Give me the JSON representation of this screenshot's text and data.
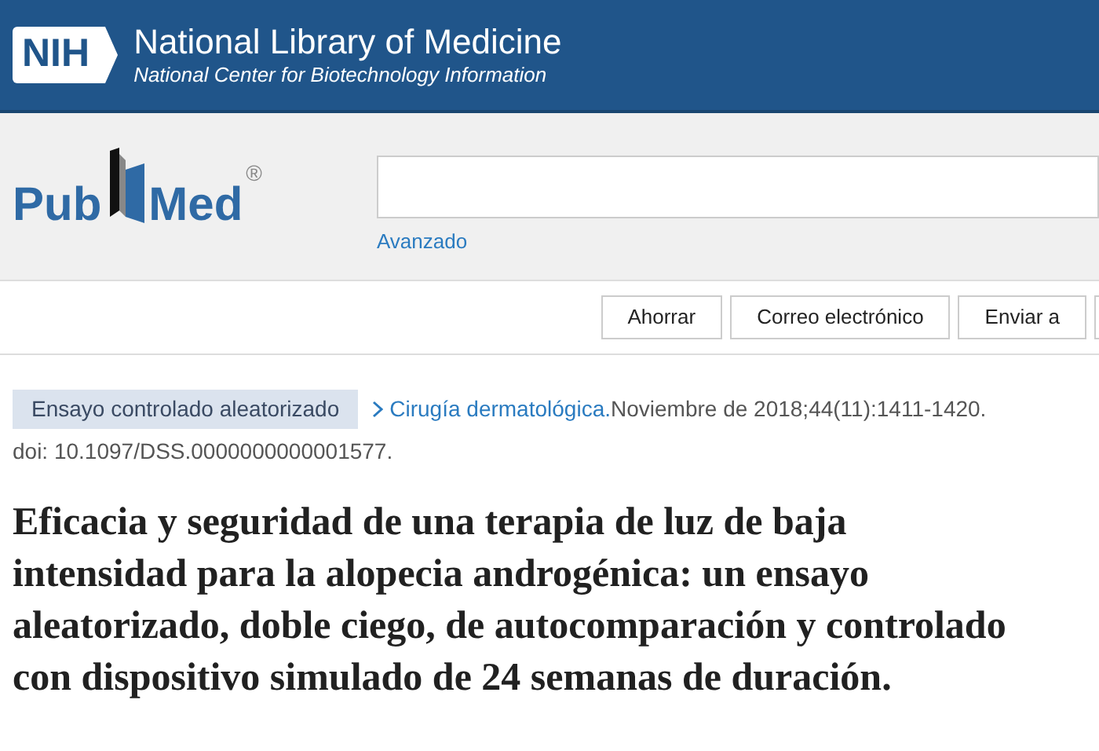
{
  "header": {
    "badge": "NIH",
    "title": "National Library of Medicine",
    "subtitle": "National Center for Biotechnology Information"
  },
  "logo": {
    "left": "Pub",
    "right": "Med",
    "mark": "®"
  },
  "search": {
    "advanced_link": "Avanzado"
  },
  "actions": [
    "Ahorrar",
    "Correo electrónico",
    "Enviar a"
  ],
  "article": {
    "type_badge": "Ensayo controlado aleatorizado",
    "journal": "Cirugía dermatológica.",
    "citation": "Noviembre de 2018;44(11):1411-1420.",
    "doi": "doi: 10.1097/DSS.0000000000001577.",
    "title": "Eficacia y seguridad de una terapia de luz de baja intensidad para la alopecia androgénica: un ensayo aleatorizado, doble ciego, de autocomparación y controlado con dispositivo simulado de 24 semanas de duración."
  }
}
